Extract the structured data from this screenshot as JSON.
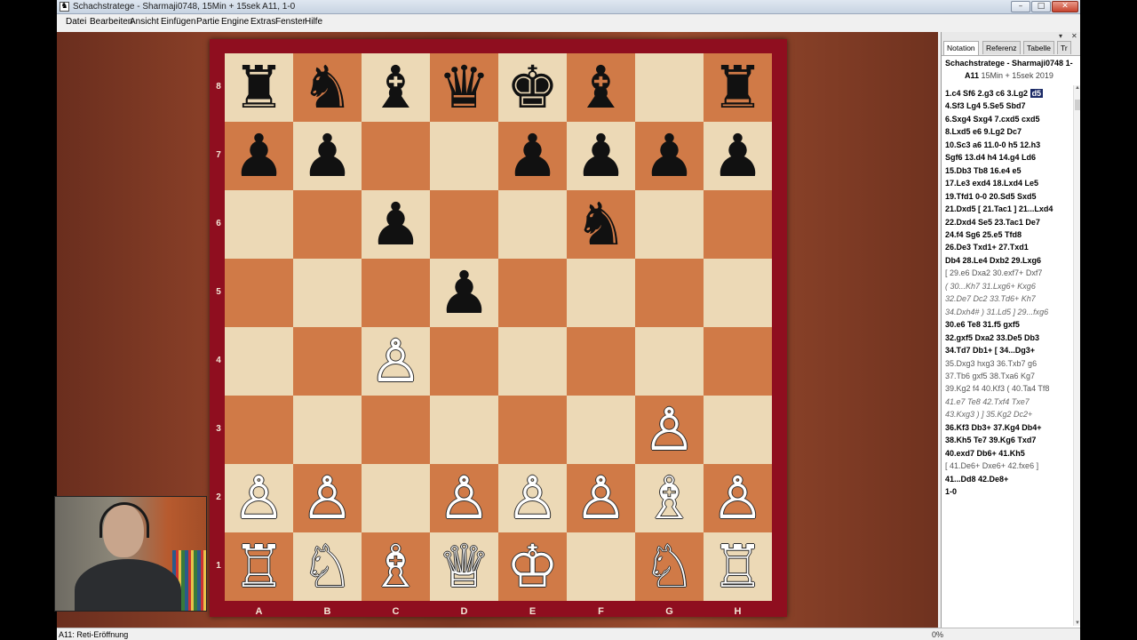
{
  "window": {
    "title": "Schachstratege - Sharmaji0748, 15Min + 15sek  A11, 1-0",
    "controls": [
      "–",
      "□",
      "✕"
    ]
  },
  "menu": [
    "Datei",
    "Bearbeiten",
    "Ansicht",
    "Einfügen",
    "Partie",
    "Engine",
    "Extras",
    "Fenster",
    "Hilfe"
  ],
  "board": {
    "ranks": [
      "8",
      "7",
      "6",
      "5",
      "4",
      "3",
      "2",
      "1"
    ],
    "files": [
      "A",
      "B",
      "C",
      "D",
      "E",
      "F",
      "G",
      "H"
    ],
    "squares": [
      [
        "♜",
        "♞",
        "♝",
        "♛",
        "♚",
        "♝",
        "",
        "♜"
      ],
      [
        "♟",
        "♟",
        "",
        "",
        "♟",
        "♟",
        "♟",
        "♟"
      ],
      [
        "",
        "",
        "♟",
        "",
        "",
        "♞",
        "",
        ""
      ],
      [
        "",
        "",
        "",
        "♟",
        "",
        "",
        "",
        ""
      ],
      [
        "",
        "",
        "♙",
        "",
        "",
        "",
        "",
        ""
      ],
      [
        "",
        "",
        "",
        "",
        "",
        "",
        "♙",
        ""
      ],
      [
        "♙",
        "♙",
        "",
        "♙",
        "♙",
        "♙",
        "♗",
        "♙"
      ],
      [
        "♖",
        "♘",
        "♗",
        "♕",
        "♔",
        "",
        "♘",
        "♖"
      ]
    ],
    "colors": {
      "light": "#ecd9b6",
      "dark": "#d07a47",
      "frame": "#8f0e1f"
    }
  },
  "panel": {
    "tabs": [
      "Notation",
      "Referenz",
      "Tabelle",
      "Tr"
    ],
    "header": "Schachstratege - Sharmaji0748  1-",
    "eco": "A11",
    "meta": "15Min + 15sek 2019",
    "lines": [
      {
        "t": "1.c4  Sf6  2.g3  c6  3.Lg2 ",
        "hl": "d5",
        "cls": "main"
      },
      {
        "t": "4.Sf3  Lg4  5.Se5  Sbd7",
        "cls": "main"
      },
      {
        "t": "6.Sxg4  Sxg4  7.cxd5  cxd5",
        "cls": "main"
      },
      {
        "t": "8.Lxd5  e6  9.Lg2  Dc7",
        "cls": "main"
      },
      {
        "t": "10.Sc3  a6  11.0-0  h5  12.h3",
        "cls": "main"
      },
      {
        "t": "Sgf6  13.d4  h4  14.g4  Ld6",
        "cls": "main"
      },
      {
        "t": "15.Db3  Tb8  16.e4  e5",
        "cls": "main"
      },
      {
        "t": "17.Le3  exd4  18.Lxd4  Le5",
        "cls": "main"
      },
      {
        "t": "19.Tfd1  0-0  20.Sd5  Sxd5",
        "cls": "main"
      },
      {
        "t": "21.Dxd5  [ 21.Tac1 ]  21...Lxd4",
        "cls": "main"
      },
      {
        "t": "22.Dxd4  Se5  23.Tac1  De7",
        "cls": "main"
      },
      {
        "t": "24.f4  Sg6  25.e5  Tfd8",
        "cls": "main"
      },
      {
        "t": "26.De3  Txd1+  27.Txd1",
        "cls": "main"
      },
      {
        "t": "Db4  28.Le4  Dxb2  29.Lxg6",
        "cls": "main"
      },
      {
        "t": "[ 29.e6  Dxa2  30.exf7+  Dxf7",
        "cls": "var"
      },
      {
        "t": "( 30...Kh7  31.Lxg6+  Kxg6",
        "cls": "vi"
      },
      {
        "t": "32.De7  Dc2  33.Td6+  Kh7",
        "cls": "vi"
      },
      {
        "t": "34.Dxh4# )  31.Ld5 ]  29...fxg6",
        "cls": "vi"
      },
      {
        "t": "30.e6  Te8  31.f5  gxf5",
        "cls": "main"
      },
      {
        "t": "32.gxf5  Dxa2  33.De5  Db3",
        "cls": "main"
      },
      {
        "t": "34.Td7  Db1+  [ 34...Dg3+",
        "cls": "main"
      },
      {
        "t": "35.Dxg3  hxg3  36.Txb7  g6",
        "cls": "var"
      },
      {
        "t": "37.Tb6  gxf5  38.Txa6  Kg7",
        "cls": "var"
      },
      {
        "t": "39.Kg2  f4  40.Kf3  ( 40.Ta4  Tf8",
        "cls": "var"
      },
      {
        "t": "41.e7  Te8  42.Txf4  Txe7",
        "cls": "vi"
      },
      {
        "t": "43.Kxg3 ) ]  35.Kg2  Dc2+",
        "cls": "vi"
      },
      {
        "t": "36.Kf3  Db3+  37.Kg4  Db4+",
        "cls": "main"
      },
      {
        "t": "38.Kh5  Te7  39.Kg6  Txd7",
        "cls": "main"
      },
      {
        "t": "40.exd7  Db6+  41.Kh5",
        "cls": "main"
      },
      {
        "t": "[ 41.De6+  Dxe6+  42.fxe6 ]",
        "cls": "var"
      },
      {
        "t": "41...Dd8  42.De8+",
        "cls": "main"
      },
      {
        "t": "1-0",
        "cls": "main"
      }
    ]
  },
  "status": {
    "opening": "A11: Reti-Eröffnung",
    "progress": "0%"
  }
}
